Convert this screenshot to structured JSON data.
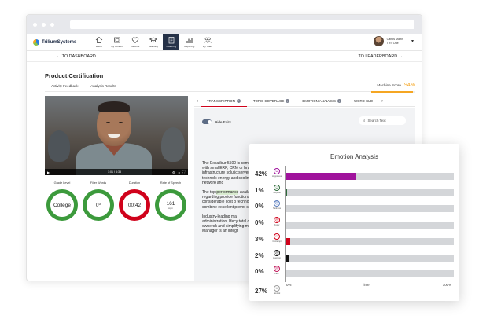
{
  "browser": {
    "app_name": "TriliumSystems"
  },
  "nav": {
    "items": [
      {
        "label": "Home",
        "icon": "home-icon"
      },
      {
        "label": "My Content",
        "icon": "folder-icon"
      },
      {
        "label": "Favorite",
        "icon": "heart-icon"
      },
      {
        "label": "Learning",
        "icon": "graduation-cap-icon"
      },
      {
        "label": "Coaching",
        "icon": "clipboard-icon",
        "active": true
      },
      {
        "label": "Reporting",
        "icon": "bar-chart-icon"
      },
      {
        "label": "My Team",
        "icon": "team-icon"
      }
    ],
    "user_name": "Carlos Martin",
    "user_org": "TRS One"
  },
  "links": {
    "back": "← TO DASHBOARD",
    "forward": "TO LEADERBOARD →"
  },
  "page": {
    "title": "Product Certification",
    "tabs": [
      "Activity Feedback",
      "Analysis Results"
    ],
    "active_tab": 1,
    "machine_score_label": "Machine Score",
    "machine_score": "94%",
    "machine_score_fraction": 0.94
  },
  "video": {
    "time": "1:01 / 6:35"
  },
  "metrics": [
    {
      "label": "Grade Level",
      "value": "College",
      "unit": "",
      "color": "#3c9a3c"
    },
    {
      "label": "Filler Words",
      "value": "0⁰",
      "unit": "",
      "color": "#3c9a3c"
    },
    {
      "label": "Duration",
      "value": "00:42",
      "unit": "",
      "color": "#d0021b"
    },
    {
      "label": "Rate of Speech",
      "value": "161",
      "unit": "wpm",
      "color": "#3c9a3c"
    }
  ],
  "right_tabs": [
    "TRANSCRIPTION",
    "TOPIC COVERAGE",
    "EMOTION ANALYSIS",
    "WORD CLO"
  ],
  "transcript": {
    "toggle_label": "Hide Edits",
    "search_placeholder": "Search Text",
    "para1": "The Excalibur 5500 is companies with smal ERP, CRM or branch- infrastructure solutic server blade technolc energy and cooling c network and",
    "para2_pre": "The top ",
    "para2_hl": "performance",
    "para2_post": " availability regarding provide functions wh considerable cost b technology combine excellent power supp",
    "para3": "Industry-leading ma administration, lifecy total cost of ownersh and simplifying mana Manager is an integr"
  },
  "emotion": {
    "title": "Emotion Analysis",
    "rows": [
      {
        "pct": "42%",
        "label": "Happiness",
        "glyph": "☺",
        "value": 0.42,
        "color": "#a0139c"
      },
      {
        "pct": "1%",
        "label": "Surprise",
        "glyph": "☺",
        "value": 0.01,
        "color": "#2e6b3a"
      },
      {
        "pct": "0%",
        "label": "Sadness",
        "glyph": "☹",
        "value": 0.0,
        "color": "#5c7fc0"
      },
      {
        "pct": "0%",
        "label": "Anger",
        "glyph": "☹",
        "value": 0.0,
        "color": "#d0021b"
      },
      {
        "pct": "3%",
        "label": "Contempt",
        "glyph": "☺",
        "value": 0.03,
        "color": "#d0021b"
      },
      {
        "pct": "2%",
        "label": "Aversion",
        "glyph": "☹",
        "value": 0.02,
        "color": "#111111"
      },
      {
        "pct": "0%",
        "label": "Fear",
        "glyph": "☹",
        "value": 0.0,
        "color": "#c2185b"
      },
      {
        "pct": "27%",
        "label": "Neutral",
        "glyph": "☺",
        "value": 0.27,
        "color": "#9e9e9e"
      }
    ],
    "x_start": "0%",
    "x_mid": "Time",
    "x_end": "100%"
  }
}
